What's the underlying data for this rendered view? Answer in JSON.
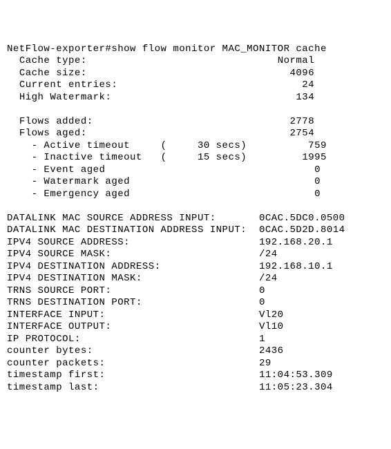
{
  "prompt": "NetFlow-exporter#",
  "command": "show flow monitor MAC_MONITOR cache",
  "cache": {
    "type_label": "Cache type:",
    "type_value": "Normal",
    "size_label": "Cache size:",
    "size_value": "4096",
    "current_label": "Current entries:",
    "current_value": "24",
    "high_label": "High Watermark:",
    "high_value": "134"
  },
  "flows": {
    "added_label": "Flows added:",
    "added_value": "2778",
    "aged_label": "Flows aged:",
    "aged_value": "2754",
    "active_label": "- Active timeout",
    "active_paren": "(     30 secs)",
    "active_value": "759",
    "inactive_label": "- Inactive timeout",
    "inactive_paren": "(     15 secs)",
    "inactive_value": "1995",
    "event_label": "- Event aged",
    "event_value": "0",
    "watermark_label": "- Watermark aged",
    "watermark_value": "0",
    "emergency_label": "- Emergency aged",
    "emergency_value": "0"
  },
  "record": {
    "mac_src_label": "DATALINK MAC SOURCE ADDRESS INPUT:",
    "mac_src_value": "0CAC.5DC0.0500",
    "mac_dst_label": "DATALINK MAC DESTINATION ADDRESS INPUT:",
    "mac_dst_value": "0CAC.5D2D.8014",
    "ipv4_src_label": "IPV4 SOURCE ADDRESS:",
    "ipv4_src_value": "192.168.20.1",
    "ipv4_src_mask_label": "IPV4 SOURCE MASK:",
    "ipv4_src_mask_value": "/24",
    "ipv4_dst_label": "IPV4 DESTINATION ADDRESS:",
    "ipv4_dst_value": "192.168.10.1",
    "ipv4_dst_mask_label": "IPV4 DESTINATION MASK:",
    "ipv4_dst_mask_value": "/24",
    "trns_src_label": "TRNS SOURCE PORT:",
    "trns_src_value": "0",
    "trns_dst_label": "TRNS DESTINATION PORT:",
    "trns_dst_value": "0",
    "if_in_label": "INTERFACE INPUT:",
    "if_in_value": "Vl20",
    "if_out_label": "INTERFACE OUTPUT:",
    "if_out_value": "Vl10",
    "ip_proto_label": "IP PROTOCOL:",
    "ip_proto_value": "1",
    "bytes_label": "counter bytes:",
    "bytes_value": "2436",
    "packets_label": "counter packets:",
    "packets_value": "29",
    "ts_first_label": "timestamp first:",
    "ts_first_value": "11:04:53.309",
    "ts_last_label": "timestamp last:",
    "ts_last_value": "11:05:23.304"
  }
}
